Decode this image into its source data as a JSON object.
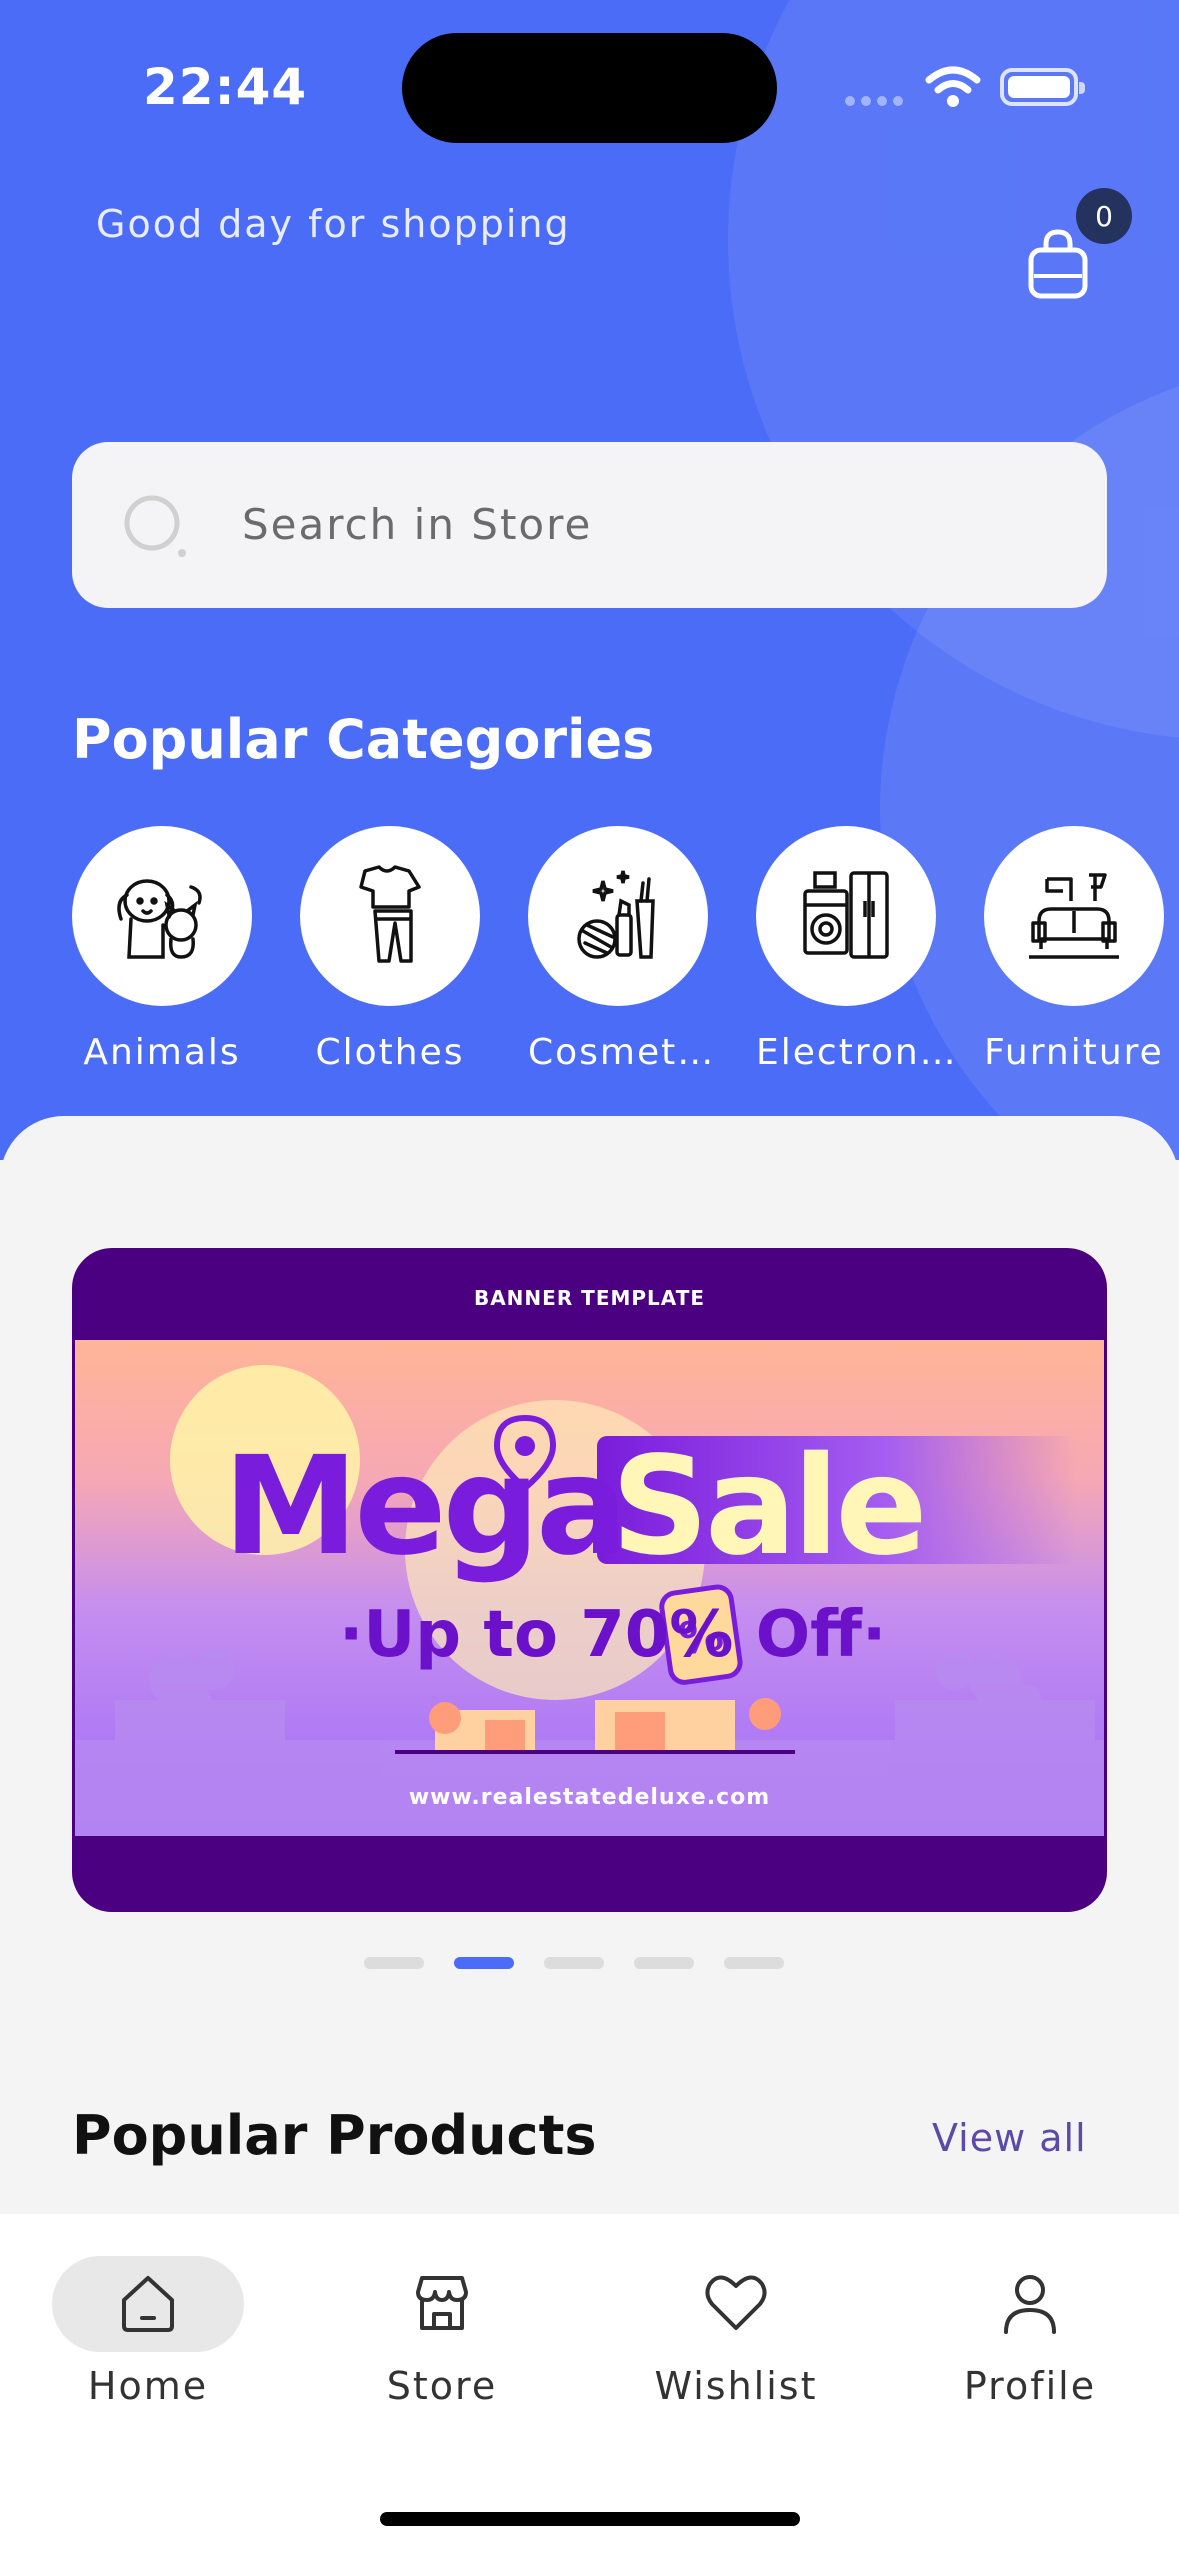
{
  "status_bar": {
    "time": "22:44"
  },
  "header": {
    "greeting": "Good day for shopping",
    "cart_count": "0"
  },
  "search": {
    "placeholder": "Search in Store"
  },
  "categories": {
    "title": "Popular Categories",
    "items": [
      {
        "label": "Animals",
        "icon": "animals-icon"
      },
      {
        "label": "Clothes",
        "icon": "clothes-icon"
      },
      {
        "label": "Cosmet…",
        "icon": "cosmetics-icon"
      },
      {
        "label": "Electron…",
        "icon": "electronics-icon"
      },
      {
        "label": "Furniture",
        "icon": "furniture-icon"
      }
    ]
  },
  "banner": {
    "header": "BANNER TEMPLATE",
    "title_part1": "Mega",
    "title_part2": "Sale",
    "subtitle": "·Up to 70% Off·",
    "url": "www.realestatedeluxe.com",
    "carousel": {
      "count": 5,
      "active_index": 1
    }
  },
  "products": {
    "title": "Popular Products",
    "view_all": "View all"
  },
  "bottom_nav": {
    "items": [
      {
        "label": "Home",
        "icon": "home-icon",
        "active": true
      },
      {
        "label": "Store",
        "icon": "store-icon",
        "active": false
      },
      {
        "label": "Wishlist",
        "icon": "heart-icon",
        "active": false
      },
      {
        "label": "Profile",
        "icon": "user-icon",
        "active": false
      }
    ]
  },
  "colors": {
    "primary": "#4b6cf7",
    "badge": "#24325e",
    "banner_purple": "#4b0082",
    "view_all": "#5b4aa8"
  }
}
